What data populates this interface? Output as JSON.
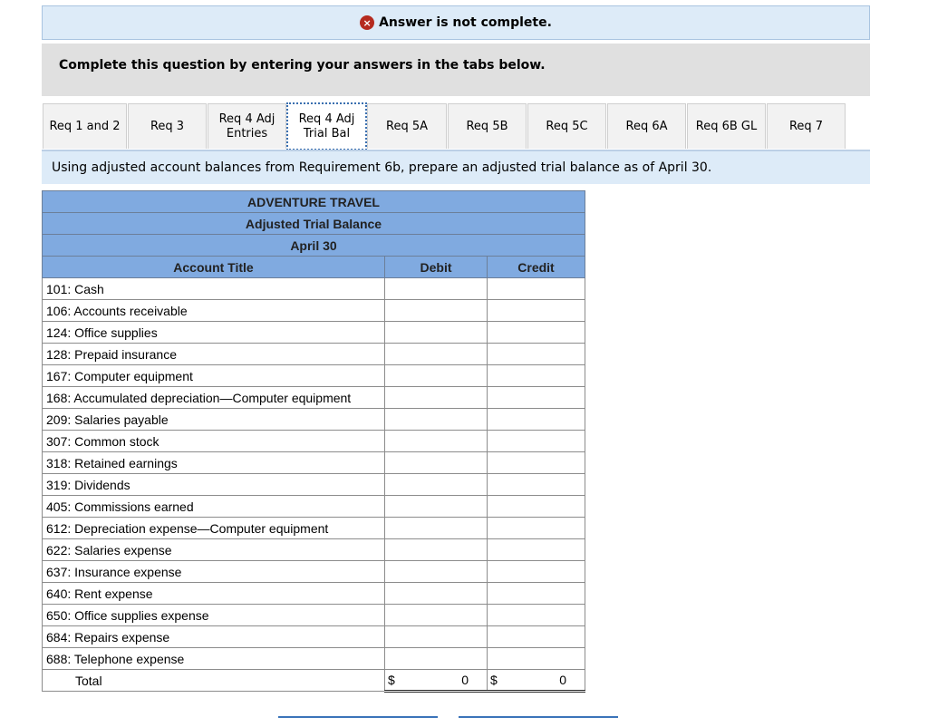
{
  "status": {
    "icon": "error-x-icon",
    "icon_glyph": "×",
    "message": "Answer is not complete.",
    "color": "#b52a1f"
  },
  "instruction": "Complete this question by entering your answers in the tabs below.",
  "tabs": [
    {
      "label": "Req 1 and 2",
      "active": false
    },
    {
      "label": "Req 3",
      "active": false
    },
    {
      "label": "Req 4 Adj Entries",
      "active": false
    },
    {
      "label": "Req 4 Adj Trial Bal",
      "active": true
    },
    {
      "label": "Req 5A",
      "active": false
    },
    {
      "label": "Req 5B",
      "active": false
    },
    {
      "label": "Req 5C",
      "active": false
    },
    {
      "label": "Req 6A",
      "active": false
    },
    {
      "label": "Req 6B GL",
      "active": false
    },
    {
      "label": "Req 7",
      "active": false
    }
  ],
  "prompt": "Using adjusted account balances from Requirement 6b, prepare an adjusted trial balance as of April 30.",
  "trial_balance": {
    "company": "ADVENTURE TRAVEL",
    "title": "Adjusted Trial Balance",
    "date": "April 30",
    "columns": [
      "Account Title",
      "Debit",
      "Credit"
    ],
    "rows": [
      {
        "account": "101: Cash",
        "debit": "",
        "credit": ""
      },
      {
        "account": "106: Accounts receivable",
        "debit": "",
        "credit": ""
      },
      {
        "account": "124: Office supplies",
        "debit": "",
        "credit": ""
      },
      {
        "account": "128: Prepaid insurance",
        "debit": "",
        "credit": ""
      },
      {
        "account": "167: Computer equipment",
        "debit": "",
        "credit": ""
      },
      {
        "account": "168: Accumulated depreciation—Computer equipment",
        "debit": "",
        "credit": ""
      },
      {
        "account": "209: Salaries payable",
        "debit": "",
        "credit": ""
      },
      {
        "account": "307: Common stock",
        "debit": "",
        "credit": ""
      },
      {
        "account": "318: Retained earnings",
        "debit": "",
        "credit": ""
      },
      {
        "account": "319: Dividends",
        "debit": "",
        "credit": ""
      },
      {
        "account": "405: Commissions earned",
        "debit": "",
        "credit": ""
      },
      {
        "account": "612: Depreciation expense—Computer equipment",
        "debit": "",
        "credit": ""
      },
      {
        "account": "622: Salaries expense",
        "debit": "",
        "credit": ""
      },
      {
        "account": "637: Insurance expense",
        "debit": "",
        "credit": ""
      },
      {
        "account": "640: Rent expense",
        "debit": "",
        "credit": ""
      },
      {
        "account": "650: Office supplies expense",
        "debit": "",
        "credit": ""
      },
      {
        "account": "684: Repairs expense",
        "debit": "",
        "credit": ""
      },
      {
        "account": "688: Telephone expense",
        "debit": "",
        "credit": ""
      }
    ],
    "total": {
      "label": "Total",
      "currency": "$",
      "debit": "0",
      "credit": "0"
    }
  }
}
